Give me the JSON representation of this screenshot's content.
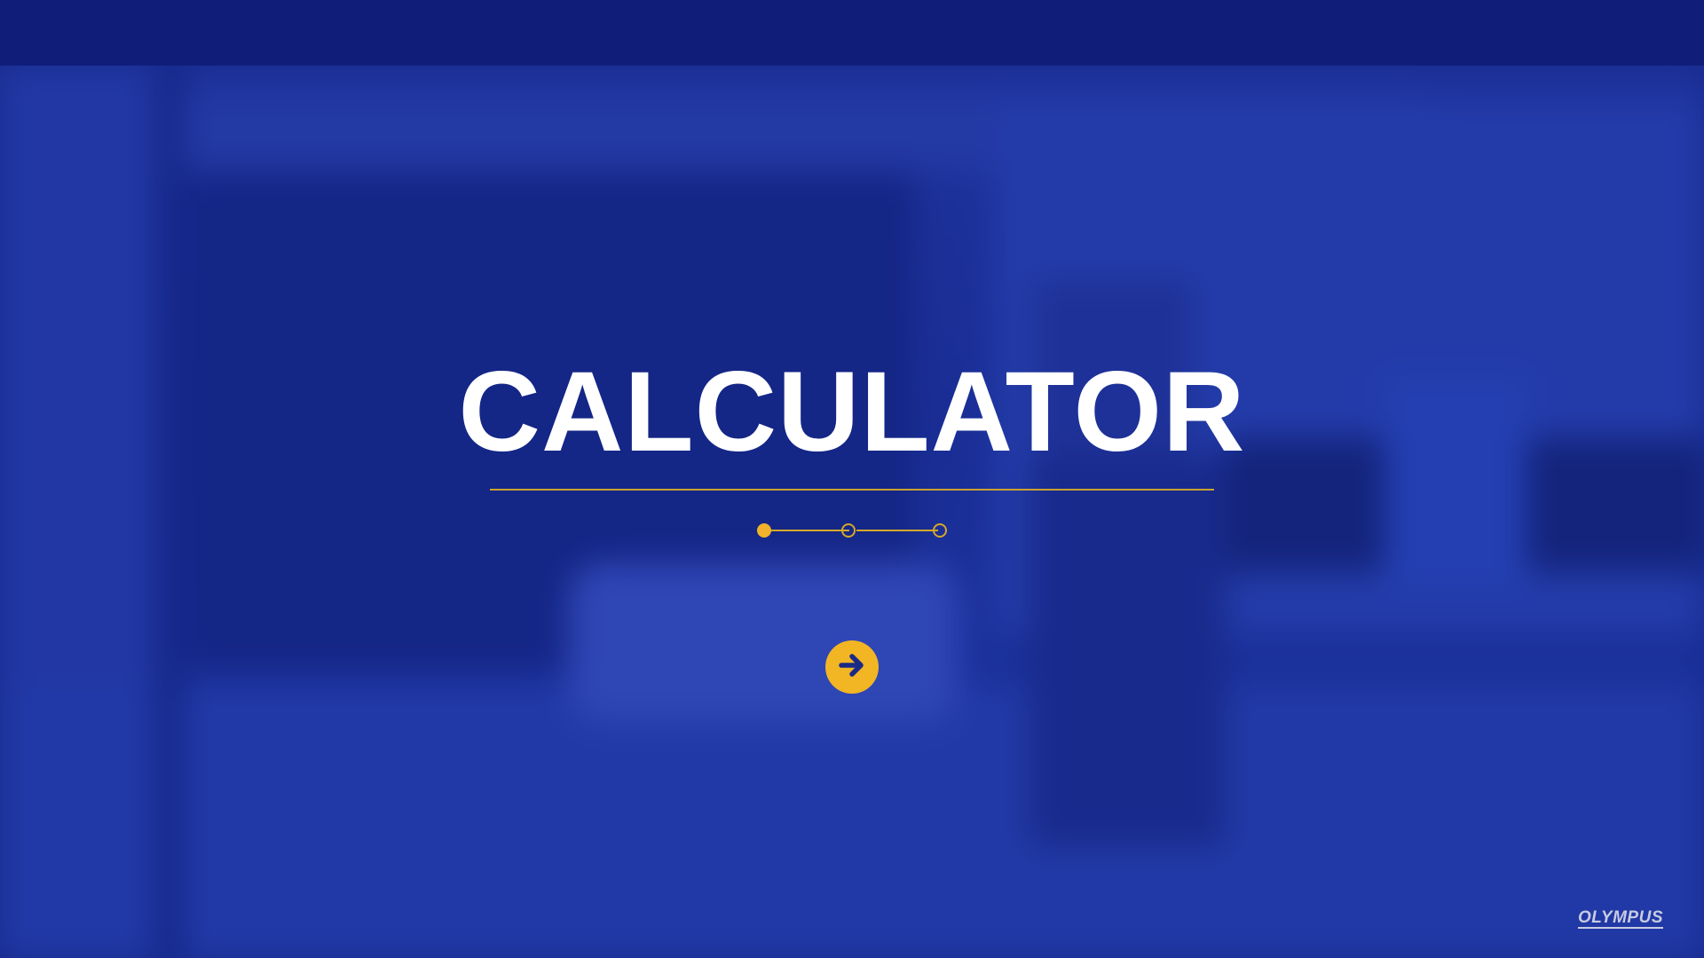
{
  "title": "CALCULATOR",
  "progress": {
    "current_step": 1,
    "total_steps": 3
  },
  "next_button": {
    "icon": "arrow-right-icon"
  },
  "brand": {
    "logo_text": "OLYMPUS"
  },
  "colors": {
    "topbar": "#101e7a",
    "overlay": "#1a2e8c",
    "accent": "#f2b524",
    "title_text": "#ffffff"
  }
}
